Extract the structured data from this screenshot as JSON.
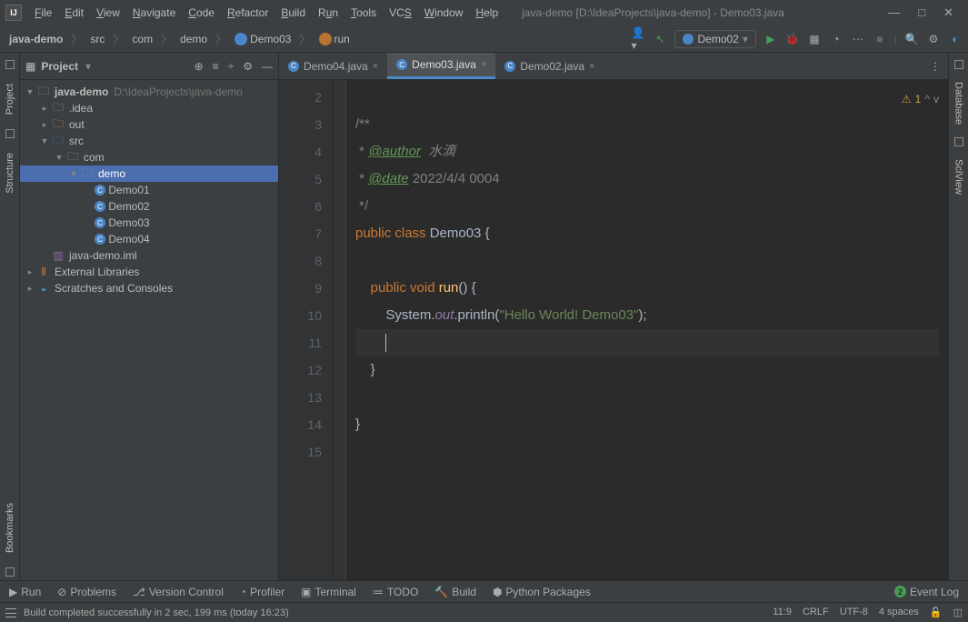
{
  "title": "java-demo [D:\\IdeaProjects\\java-demo] - Demo03.java",
  "menu": [
    "File",
    "Edit",
    "View",
    "Navigate",
    "Code",
    "Refactor",
    "Build",
    "Run",
    "Tools",
    "VCS",
    "Window",
    "Help"
  ],
  "breadcrumb": {
    "root": "java-demo",
    "p1": "src",
    "p2": "com",
    "p3": "demo",
    "cls": "Demo03",
    "m": "run"
  },
  "runconfig": "Demo02",
  "project": {
    "title": "Project",
    "root_name": "java-demo",
    "root_path": "D:\\IdeaProjects\\java-demo",
    "idea": ".idea",
    "out": "out",
    "src": "src",
    "com": "com",
    "demo": "demo",
    "files": [
      "Demo01",
      "Demo02",
      "Demo03",
      "Demo04"
    ],
    "iml": "java-demo.iml",
    "ext": "External Libraries",
    "scratch": "Scratches and Consoles"
  },
  "tabs": [
    {
      "name": "Demo04.java"
    },
    {
      "name": "Demo03.java"
    },
    {
      "name": "Demo02.java"
    }
  ],
  "code_lines": {
    "l3": "/**",
    "l4a": " * ",
    "l4b": "@author",
    "l4c": "  水滴",
    "l5a": " * ",
    "l5b": "@date",
    "l5c": " 2022/4/4 0004",
    "l6": " */",
    "l7a": "public ",
    "l7b": "class ",
    "l7c": "Demo03 {",
    "l9a": "    public ",
    "l9b": "void ",
    "l9c": "run",
    "l9d": "() {",
    "l10a": "        System.",
    "l10b": "out",
    "l10c": ".println(",
    "l10d": "\"Hello World! Demo03\"",
    "l10e": ");",
    "l12": "    }",
    "l14": "}"
  },
  "gutter": [
    "2",
    "3",
    "4",
    "5",
    "6",
    "7",
    "8",
    "9",
    "10",
    "11",
    "12",
    "13",
    "14",
    "15"
  ],
  "warn_count": "1",
  "bottom": {
    "run": "Run",
    "problems": "Problems",
    "vc": "Version Control",
    "profiler": "Profiler",
    "terminal": "Terminal",
    "todo": "TODO",
    "build": "Build",
    "python": "Python Packages",
    "event": "Event Log",
    "event_n": "2"
  },
  "status": {
    "msg": "Build completed successfully in 2 sec, 199 ms (today 16:23)",
    "pos": "11:9",
    "le": "CRLF",
    "enc": "UTF-8",
    "indent": "4 spaces"
  },
  "right_tools": {
    "db": "Database",
    "sci": "SciView"
  },
  "left_tools": {
    "proj": "Project",
    "struct": "Structure",
    "bm": "Bookmarks"
  }
}
